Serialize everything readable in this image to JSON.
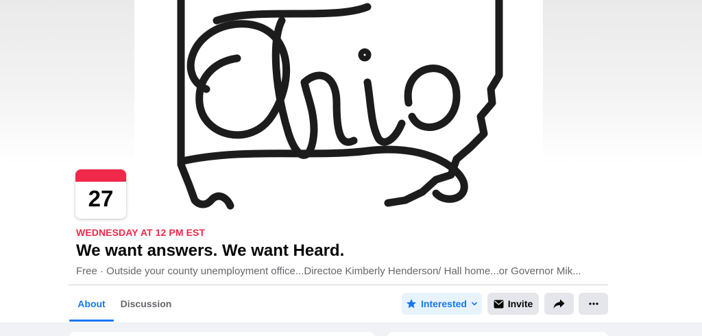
{
  "event": {
    "day_number": "27",
    "when": "WEDNESDAY AT 12 PM EST",
    "title": "We want answers. We want Heard.",
    "subtitle": "Free · Outside your county unemployment office...Directoe Kimberly Henderson/ Hall home...or Governor Mik...",
    "cover_text": "Ohio"
  },
  "tabs": [
    {
      "label": "About",
      "active": true
    },
    {
      "label": "Discussion",
      "active": false
    }
  ],
  "actions": {
    "interested_label": "Interested",
    "invite_label": "Invite",
    "share_icon": "share-arrow-icon",
    "more_icon": "more-dots-icon"
  },
  "colors": {
    "accent": "#1877f2",
    "date_red": "#f02849"
  }
}
